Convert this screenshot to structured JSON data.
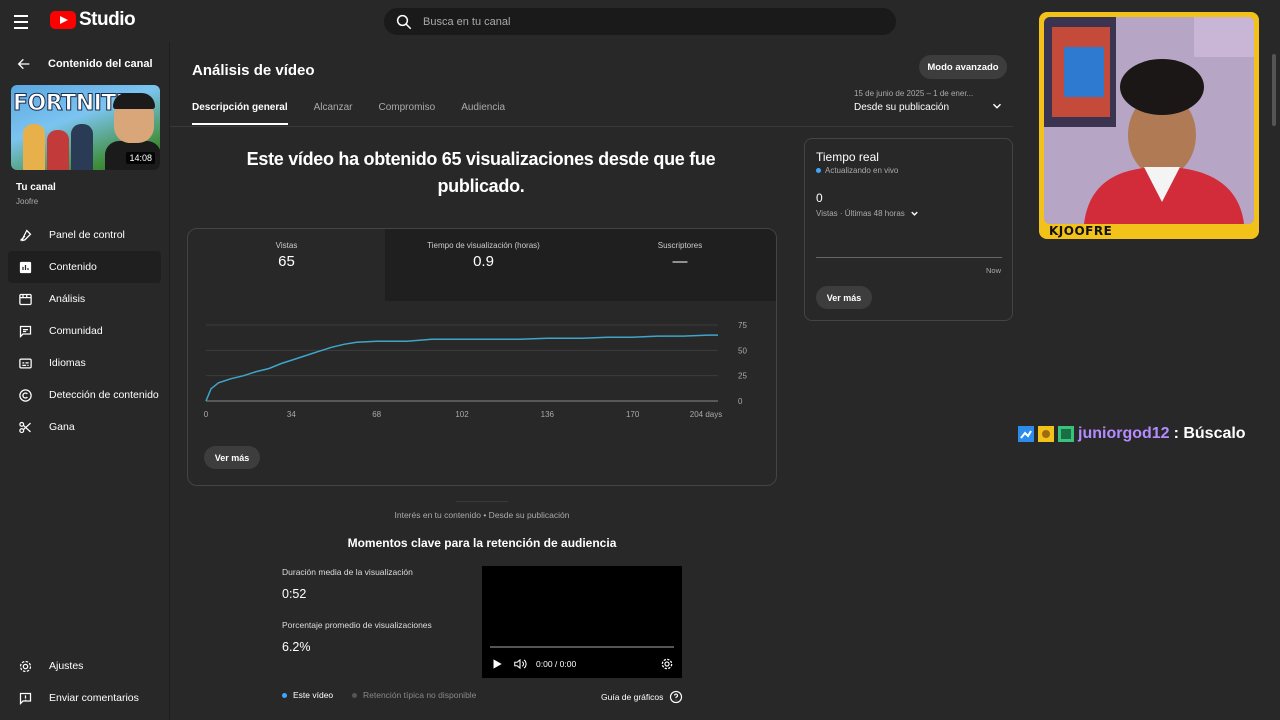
{
  "app": {
    "logo_text": "Studio"
  },
  "search": {
    "placeholder": "Busca en tu canal"
  },
  "sidebar": {
    "back_label": "Contenido del canal",
    "video_thumb": {
      "title_text": "FORTNITE",
      "duration": "14:08"
    },
    "channel_name": "Tu canal",
    "channel_handle": "Joofre",
    "items": [
      {
        "label": "Panel de control",
        "icon": "dashboard-icon"
      },
      {
        "label": "Contenido",
        "icon": "content-icon"
      },
      {
        "label": "Análisis",
        "icon": "analytics-icon"
      },
      {
        "label": "Comunidad",
        "icon": "community-icon"
      },
      {
        "label": "Idiomas",
        "icon": "subtitles-icon"
      },
      {
        "label": "Detección de contenido",
        "icon": "copyright-icon"
      },
      {
        "label": "Gana",
        "icon": "earn-icon"
      }
    ],
    "bottom_items": [
      {
        "label": "Ajustes",
        "icon": "settings-icon"
      },
      {
        "label": "Enviar comentarios",
        "icon": "feedback-icon"
      }
    ]
  },
  "main": {
    "title": "Análisis de vídeo",
    "advanced_button": "Modo avanzado",
    "tabs": [
      "Descripción general",
      "Alcanzar",
      "Compromiso",
      "Audiencia"
    ],
    "date_range": {
      "small": "15 de junio de 2025 – 1 de ener...",
      "main": "Desde su publicación"
    },
    "headline": "Este vídeo ha obtenido 65 visualizaciones desde que fue publicado.",
    "metrics": [
      {
        "label": "Vistas",
        "value": "65"
      },
      {
        "label": "Tiempo de visualización (horas)",
        "value": "0.9"
      },
      {
        "label": "Suscriptores",
        "value": "—"
      }
    ],
    "ver_mas": "Ver más",
    "interest_line": "Interés en tu contenido • Desde su publicación",
    "retention": {
      "title": "Momentos clave para la retención de audiencia",
      "avg_duration_label": "Duración media de la visualización",
      "avg_duration_value": "0:52",
      "avg_percent_label": "Porcentaje promedio de visualizaciones",
      "avg_percent_value": "6.2%",
      "player_time": "0:00 / 0:00",
      "legend_this": "Este vídeo",
      "legend_typical": "Retención típica no disponible",
      "guide": "Guía de gráficos"
    }
  },
  "realtime": {
    "title": "Tiempo real",
    "live": "Actualizando en vivo",
    "count": "0",
    "sub": "Vistas · Últimas 48 horas",
    "now": "Now",
    "ver_mas": "Ver más"
  },
  "webcam": {
    "label": "KJOOFRE"
  },
  "chat": {
    "username": "juniorgod12",
    "message": ": Búscalo"
  },
  "colors": {
    "accent_line": "#3ea6c9",
    "brand_red": "#ff0000",
    "cam_border": "#f2c21b",
    "chat_name": "#b48cff"
  },
  "chart_data": {
    "type": "line",
    "x_ticks": [
      "0",
      "34",
      "68",
      "102",
      "136",
      "170",
      "204 days"
    ],
    "y_ticks": [
      "0",
      "25",
      "50",
      "75"
    ],
    "ylim": [
      0,
      75
    ],
    "xlim": [
      0,
      204
    ],
    "x": [
      0,
      2,
      5,
      10,
      15,
      20,
      25,
      30,
      35,
      40,
      45,
      50,
      55,
      60,
      68,
      80,
      90,
      102,
      115,
      125,
      136,
      150,
      160,
      170,
      180,
      190,
      200,
      204
    ],
    "y": [
      0,
      12,
      18,
      22,
      25,
      29,
      32,
      37,
      41,
      45,
      49,
      53,
      56,
      58,
      59,
      59,
      61,
      61,
      61,
      61,
      62,
      62,
      63,
      63,
      64,
      64,
      65,
      65
    ]
  }
}
